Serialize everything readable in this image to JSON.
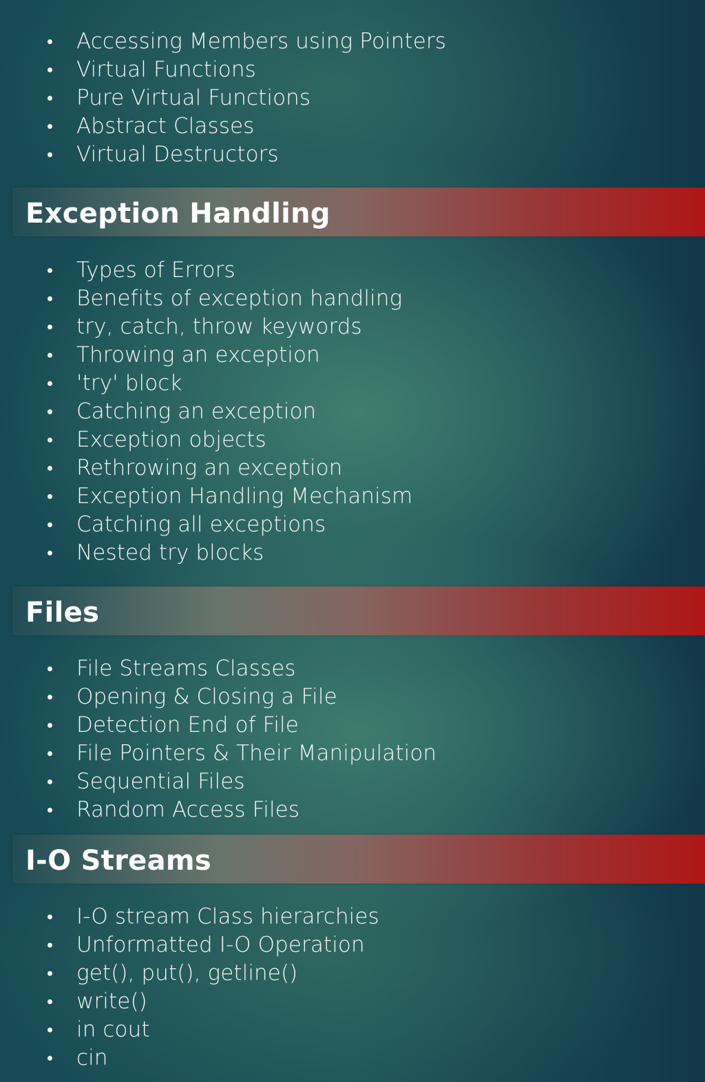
{
  "sections": [
    {
      "heading": null,
      "items": [
        "Accessing Members using Pointers",
        "Virtual Functions",
        "Pure Virtual Functions",
        "Abstract Classes",
        "Virtual Destructors"
      ]
    },
    {
      "heading": "Exception Handling",
      "items": [
        "Types of Errors",
        "Benefits of exception handling",
        "try, catch, throw keywords",
        "Throwing an exception",
        "'try' block",
        "Catching an exception",
        "Exception objects",
        "Rethrowing an exception",
        "Exception Handling Mechanism",
        "Catching all exceptions",
        "Nested try blocks"
      ]
    },
    {
      "heading": "Files",
      "items": [
        "File Streams Classes",
        "Opening & Closing a File",
        "Detection End of File",
        "File Pointers & Their Manipulation",
        "Sequential Files",
        "Random Access Files"
      ]
    },
    {
      "heading": "I-O Streams",
      "items": [
        "I-O stream Class hierarchies",
        "Unformatted I-O Operation",
        "get(), put(), getline()",
        "write()",
        "in cout",
        "cin"
      ]
    }
  ],
  "colors": {
    "banner_accent": "#b01616",
    "background_dark": "#12384a",
    "background_glow": "#42806e",
    "text": "#f4f7f6"
  },
  "bullet_icon": "bullet-dot"
}
